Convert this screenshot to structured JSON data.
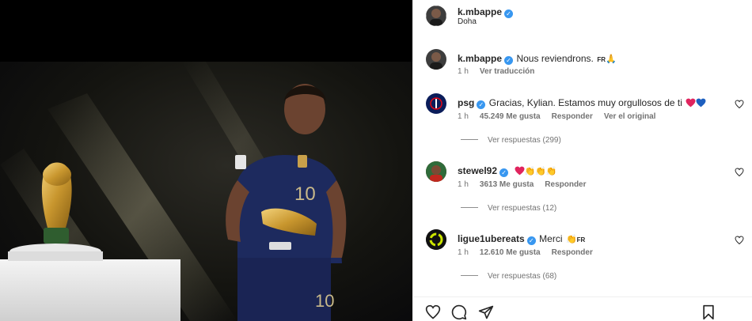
{
  "post": {
    "author": "k.mbappe",
    "location": "Doha",
    "caption_text": "Nous reviendrons.",
    "caption_flag": "FR",
    "caption_time": "1 h",
    "see_translation": "Ver traducción"
  },
  "comments": [
    {
      "user": "psg",
      "verified": true,
      "text": "Gracias, Kylian. Estamos muy orgullosos de ti",
      "time": "1 h",
      "likes": "45.249 Me gusta",
      "reply": "Responder",
      "original": "Ver el original",
      "view_replies": "Ver respuestas (299)",
      "avatar_color": "#0b1d5a"
    },
    {
      "user": "stewel92",
      "verified": true,
      "text": "",
      "time": "1 h",
      "likes": "3613 Me gusta",
      "reply": "Responder",
      "original": "",
      "view_replies": "Ver respuestas (12)",
      "avatar_color": "#7a2a22"
    },
    {
      "user": "ligue1ubereats",
      "verified": true,
      "text": "Merci",
      "flag": "FR",
      "time": "1 h",
      "likes": "12.610 Me gusta",
      "reply": "Responder",
      "original": "",
      "view_replies": "Ver respuestas (68)",
      "avatar_color": "#111111"
    }
  ],
  "icons": {
    "like": "heart-icon",
    "comment": "comment-icon",
    "share": "paper-plane-icon",
    "save": "bookmark-icon"
  },
  "colors": {
    "verified": "#3897f0",
    "heart_red": "#e0245e",
    "heart_blue": "#1d5fbf",
    "text": "#262626",
    "secondary": "#737373"
  }
}
